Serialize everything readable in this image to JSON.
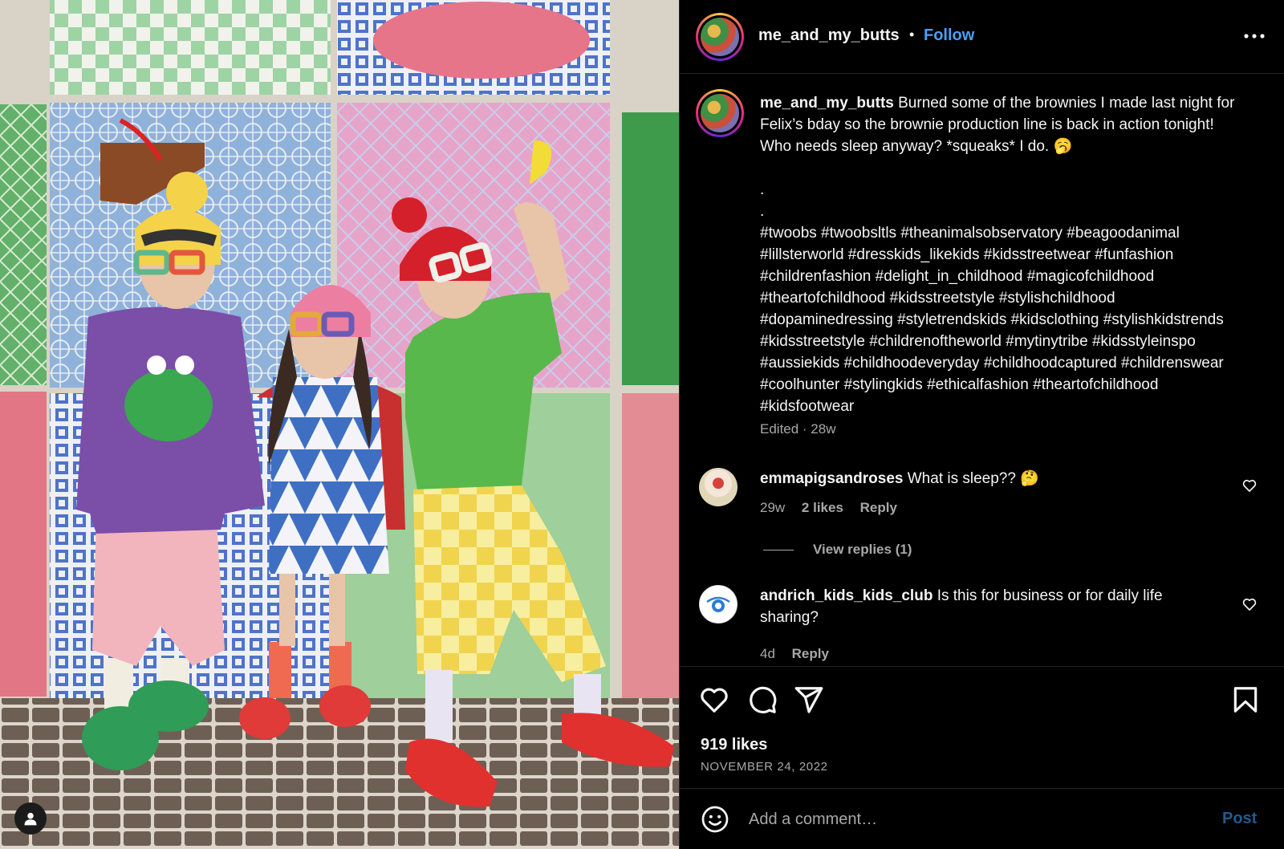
{
  "post": {
    "username": "me_and_my_butts",
    "separator": "•",
    "follow_label": "Follow",
    "more_label": "More options",
    "photo_alt": "Three children in colorful outfits posing against a painted mural wall"
  },
  "caption": {
    "username": "me_and_my_butts",
    "text": "Burned some of the brownies I made last night for Felix’s bday so the brownie production line is back in action tonight! Who needs sleep anyway? *squeaks* I do. 🥱",
    "dots": [
      ".",
      "."
    ],
    "hashtags": "#twoobs #twoobsltls #theanimalsobservatory #beagoodanimal #lillsterworld #dresskids_likekids #kidsstreetwear #funfashion #childrenfashion #delight_in_childhood #magicofchildhood #theartofchildhood #kidsstreetstyle #stylishchildhood #dopaminedressing #styletrendskids #kidsclothing #stylishkidstrends #kidsstreetstyle #childrenoftheworld #mytinytribe #kidsstyleinspo #aussiekids #childhoodeveryday #childhoodcaptured #childrenswear #coolhunter #stylingkids #ethicalfashion #theartofchildhood #kidsfootwear",
    "meta": "Edited · 28w"
  },
  "comments": [
    {
      "username": "emmapigsandroses",
      "text": "What is sleep?? 🤔",
      "time": "29w",
      "likes": "2 likes",
      "reply": "Reply"
    },
    {
      "username": "andrich_kids_kids_club",
      "text": "Is this for business or for daily life sharing?",
      "time": "4d",
      "reply": "Reply"
    }
  ],
  "view_replies": "View replies (1)",
  "stats": {
    "likes": "919 likes",
    "date": "NOVEMBER 24, 2022"
  },
  "composer": {
    "placeholder": "Add a comment…",
    "post_label": "Post"
  },
  "icons": {
    "like": "heart-icon",
    "comment": "comment-icon",
    "share": "send-icon",
    "save": "bookmark-icon",
    "emoji": "smiley-icon",
    "tag": "person-icon",
    "more": "ellipsis-icon"
  },
  "colors": {
    "background": "#000000",
    "follow": "#4aa0f7",
    "muted": "#a8a8a8",
    "post_disabled": "#1f5c8f"
  }
}
